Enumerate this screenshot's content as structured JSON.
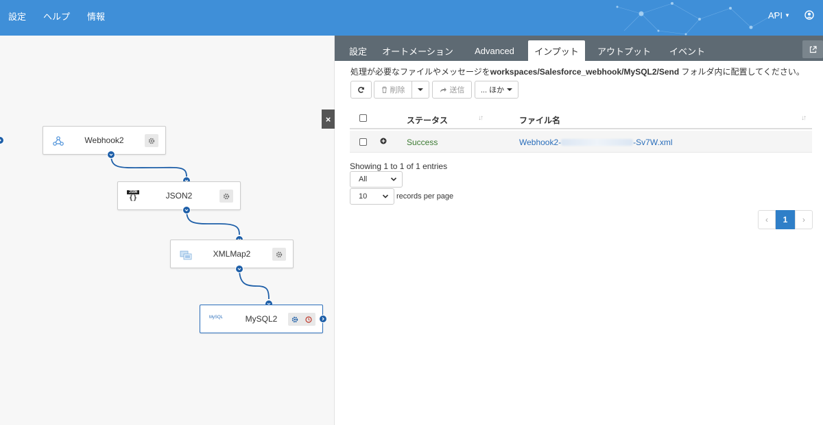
{
  "header": {
    "menu": [
      "設定",
      "ヘルプ",
      "情報"
    ],
    "api_label": "API",
    "user_icon": "user-circle-icon"
  },
  "flow": {
    "nodes": [
      {
        "label": "Webhook2",
        "icon": "webhook-icon"
      },
      {
        "label": "JSON2",
        "icon": "json-icon"
      },
      {
        "label": "XMLMap2",
        "icon": "xmlmap-icon"
      },
      {
        "label": "MySQL2",
        "icon": "mysql-icon"
      }
    ],
    "json_icon_text": "JSON",
    "mysql_icon_text": "MySQL",
    "close_label": "×"
  },
  "tabs": [
    "設定",
    "オートメーション",
    "Advanced",
    "インプット",
    "アウトプット",
    "イベント"
  ],
  "active_tab": "インプット",
  "description": {
    "prefix": "処理が必要なファイルやメッセージを",
    "path": "workspaces/Salesforce_webhook/MySQL2/Send",
    "suffix": " フォルダ内に配置してください。"
  },
  "toolbar": {
    "delete_label": "削除",
    "send_label": "送信",
    "more_label": "... ほか"
  },
  "table": {
    "columns": [
      "ステータス",
      "ファイル名"
    ],
    "rows": [
      {
        "status": "Success",
        "file_prefix": "Webhook2-",
        "file_suffix": "-Sv7W.xml"
      }
    ]
  },
  "footer": {
    "showing": "Showing 1 to 1 of 1 entries",
    "filter_value": "All",
    "page_size": "10",
    "per_page_label": "records per page",
    "current_page": "1",
    "prev": "‹",
    "next": "›"
  },
  "colors": {
    "header": "#3f8fd8",
    "tabbar": "#5e6a73",
    "success": "#3c7a32",
    "link": "#2a6ebb",
    "port": "#1e5fa8"
  }
}
